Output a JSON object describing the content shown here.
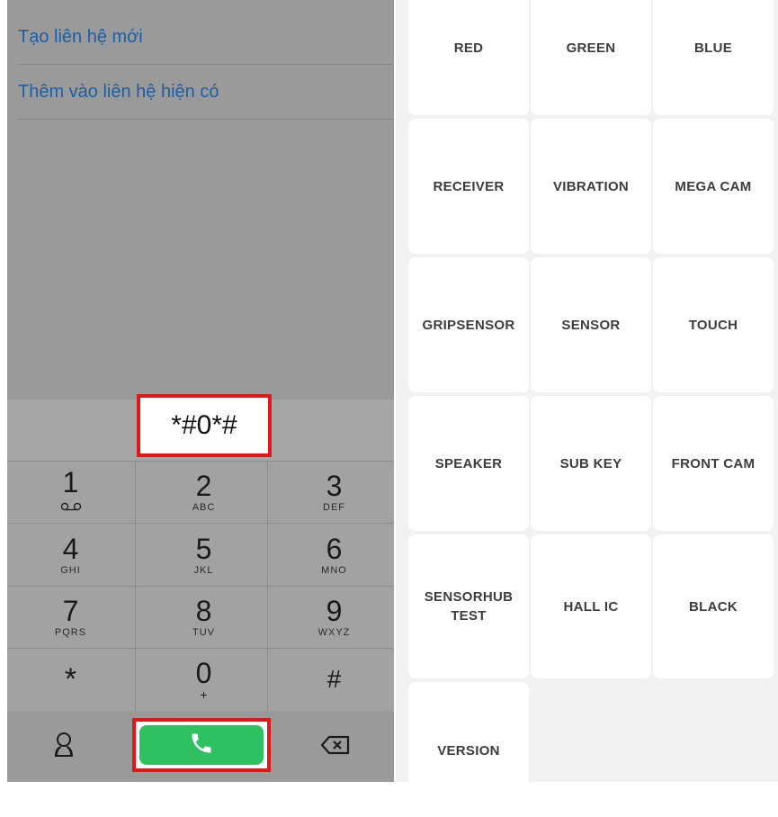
{
  "dialer": {
    "options": [
      "Tạo liên hệ mới",
      "Thêm vào liên hệ hiện có"
    ],
    "entered_number": "*#0*#",
    "keys": [
      {
        "digit": "1",
        "letters": ""
      },
      {
        "digit": "2",
        "letters": "ABC"
      },
      {
        "digit": "3",
        "letters": "DEF"
      },
      {
        "digit": "4",
        "letters": "GHI"
      },
      {
        "digit": "5",
        "letters": "JKL"
      },
      {
        "digit": "6",
        "letters": "MNO"
      },
      {
        "digit": "7",
        "letters": "PQRS"
      },
      {
        "digit": "8",
        "letters": "TUV"
      },
      {
        "digit": "9",
        "letters": "WXYZ"
      },
      {
        "digit": "*",
        "letters": ""
      },
      {
        "digit": "0",
        "letters": "+"
      },
      {
        "digit": "#",
        "letters": ""
      }
    ],
    "icons": {
      "voicemail": "voicemail-icon",
      "contacts": "person-icon",
      "call": "phone-icon",
      "backspace": "backspace-icon"
    },
    "highlight_color": "#e01818",
    "call_color": "#2ec061"
  },
  "test_menu": {
    "tiles": [
      [
        "RED",
        "GREEN",
        "BLUE"
      ],
      [
        "RECEIVER",
        "VIBRATION",
        "MEGA CAM"
      ],
      [
        "GRIPSENSOR",
        "SENSOR",
        "TOUCH"
      ],
      [
        "SPEAKER",
        "SUB KEY",
        "FRONT CAM"
      ],
      [
        "SENSORHUB\nTEST",
        "HALL IC",
        "BLACK"
      ],
      [
        "VERSION"
      ]
    ]
  }
}
